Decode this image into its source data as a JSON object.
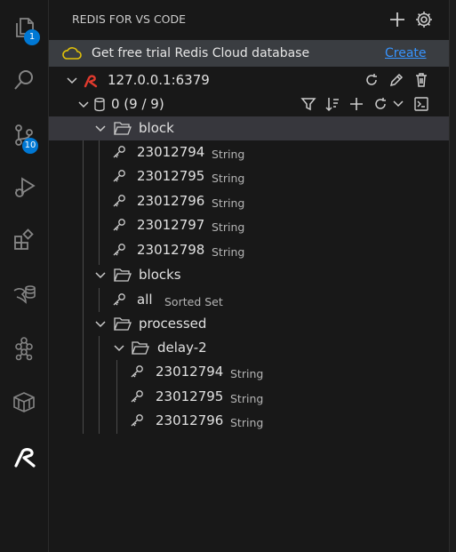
{
  "activity_bar": {
    "explorer_badge": "1",
    "source_control_badge": "10"
  },
  "header": {
    "title": "REDIS FOR VS CODE"
  },
  "banner": {
    "text": "Get free trial Redis Cloud database",
    "link_label": "Create"
  },
  "connection": {
    "label": "127.0.0.1:6379"
  },
  "database": {
    "label": "0 (9 / 9)"
  },
  "tree": {
    "block": {
      "label": "block",
      "keys": [
        {
          "name": "23012794",
          "type": "String"
        },
        {
          "name": "23012795",
          "type": "String"
        },
        {
          "name": "23012796",
          "type": "String"
        },
        {
          "name": "23012797",
          "type": "String"
        },
        {
          "name": "23012798",
          "type": "String"
        }
      ]
    },
    "blocks": {
      "label": "blocks",
      "keys": [
        {
          "name": "all",
          "type": "Sorted Set"
        }
      ]
    },
    "processed": {
      "label": "processed",
      "delay": {
        "label": "delay-2",
        "keys": [
          {
            "name": "23012794",
            "type": "String"
          },
          {
            "name": "23012795",
            "type": "String"
          },
          {
            "name": "23012796",
            "type": "String"
          }
        ]
      }
    }
  },
  "colors": {
    "redis_red": "#e03a2e",
    "accent_blue": "#0078d4",
    "link_blue": "#3794ff",
    "banner_cloud": "#e2c208",
    "selected_row": "#37373d"
  }
}
